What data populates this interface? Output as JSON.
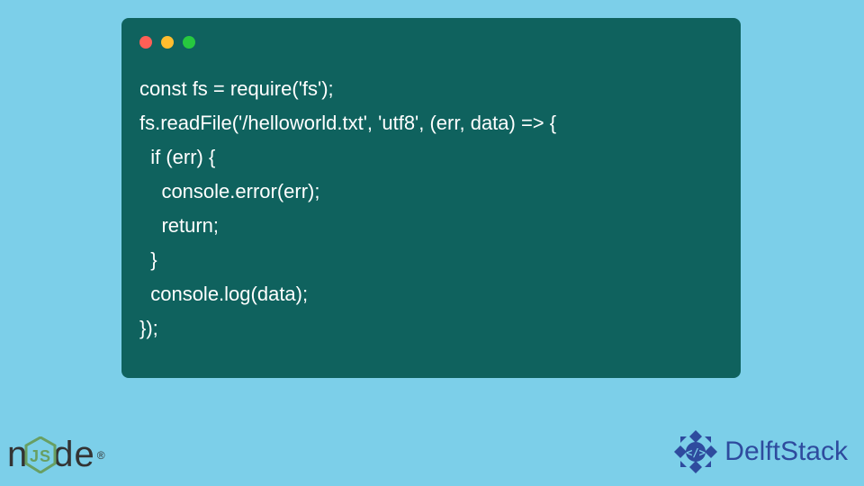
{
  "code": {
    "line1": "const fs = require('fs');",
    "line2": "fs.readFile('/helloworld.txt', 'utf8', (err, data) => {",
    "line3": "  if (err) {",
    "line4": "    console.error(err);",
    "line5": "    return;",
    "line6": "  }",
    "line7": "  console.log(data);",
    "line8": "});"
  },
  "logos": {
    "nodejs": "n   de",
    "delftstack": "DelftStack"
  }
}
